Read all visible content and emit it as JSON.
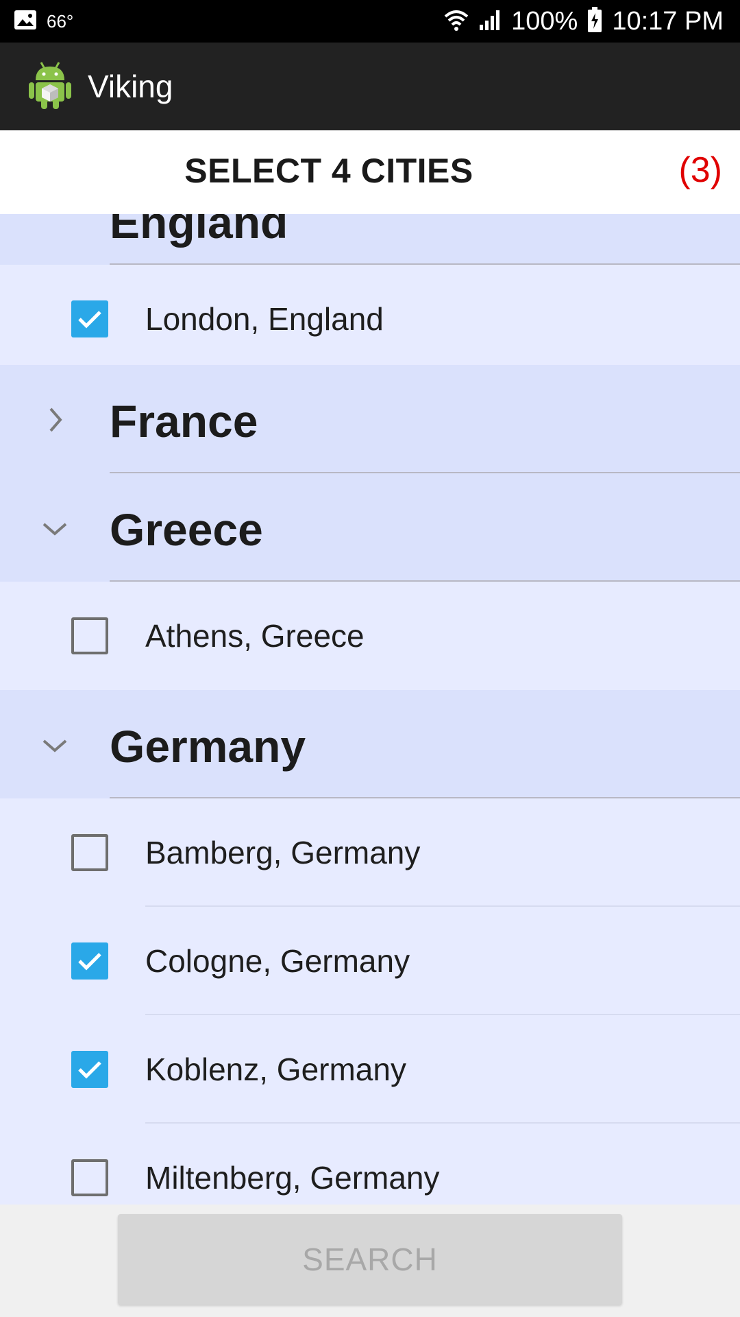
{
  "status_bar": {
    "temperature": "66°",
    "battery": "100%",
    "time": "10:17 PM"
  },
  "app_bar": {
    "title": "Viking",
    "icon": "android-icon"
  },
  "header": {
    "title": "SELECT 4 CITIES",
    "count": "(3)"
  },
  "list": {
    "partial_group": "England",
    "groups": [
      {
        "label": "France",
        "state": "collapsed"
      },
      {
        "label": "Greece",
        "state": "expanded"
      },
      {
        "label": "Germany",
        "state": "expanded"
      }
    ],
    "items": [
      {
        "label": "London, England",
        "checked": true
      },
      {
        "label": "Athens, Greece",
        "checked": false
      },
      {
        "label": "Bamberg, Germany",
        "checked": false
      },
      {
        "label": "Cologne, Germany",
        "checked": true
      },
      {
        "label": "Koblenz, Germany",
        "checked": true
      },
      {
        "label": "Miltenberg, Germany",
        "checked": false
      }
    ]
  },
  "search_button": {
    "label": "SEARCH",
    "enabled": false
  },
  "colors": {
    "accent": "#2aa8e8",
    "count": "#e00000",
    "group_bg": "#dae1fc",
    "item_bg": "#e7ebff"
  }
}
